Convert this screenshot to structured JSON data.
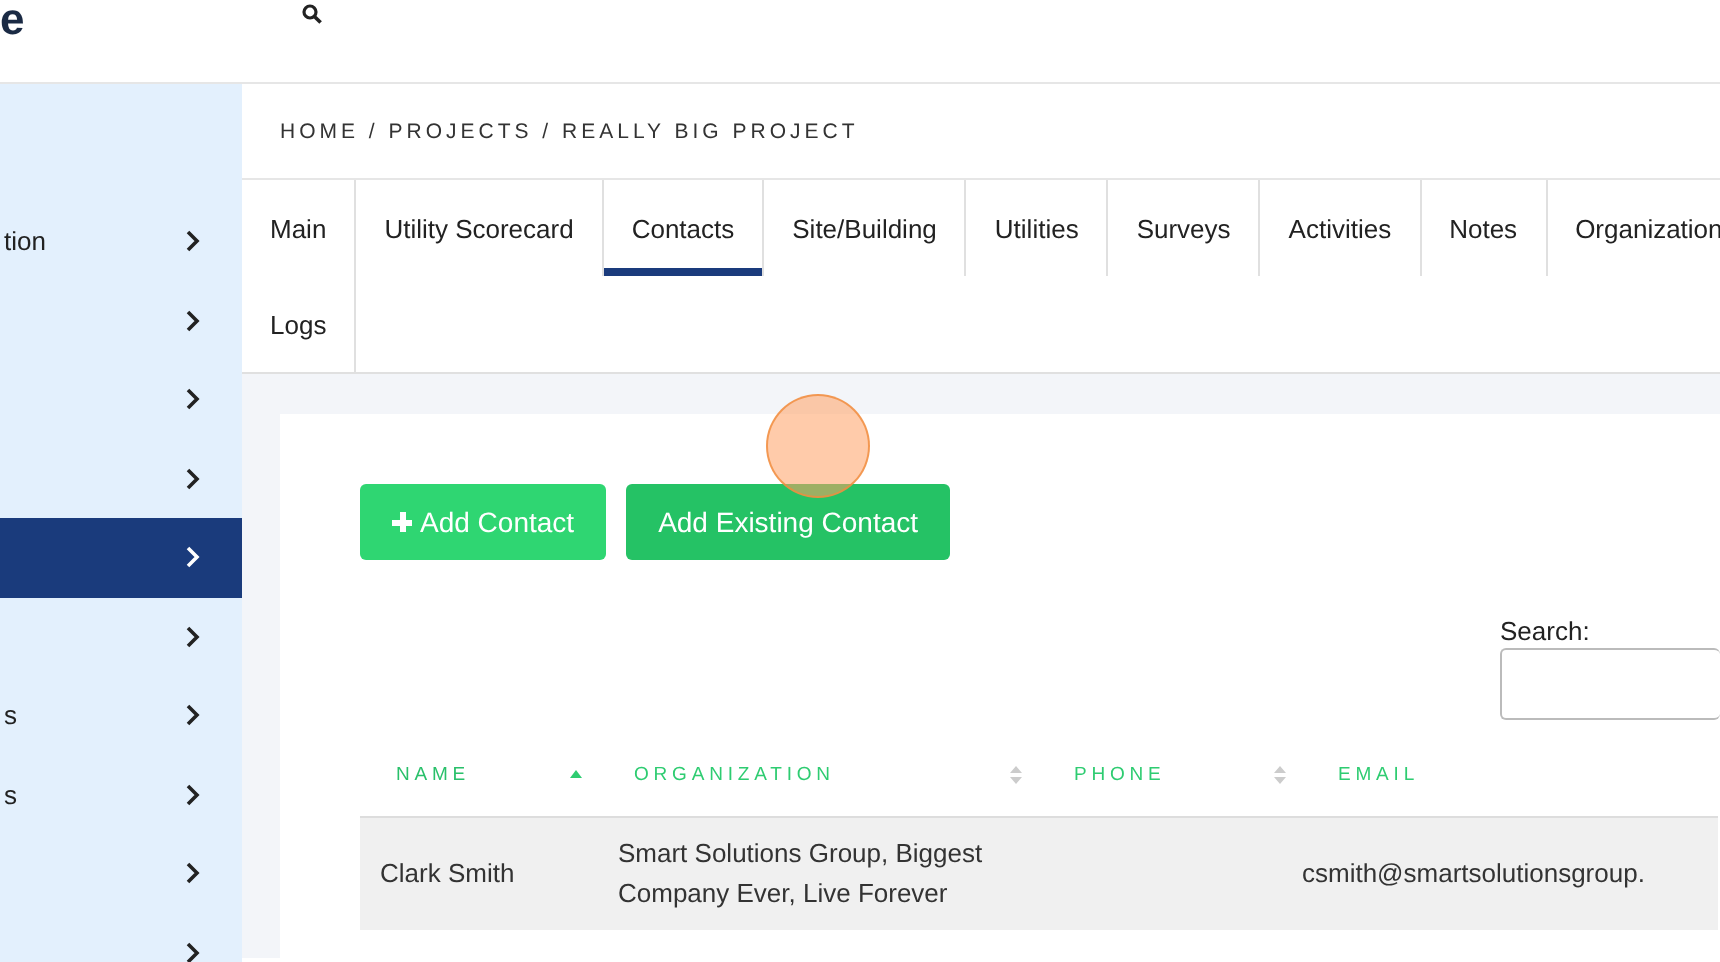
{
  "header": {
    "logo": "e"
  },
  "sidebar": {
    "items": [
      {
        "label": "tion",
        "selected": false
      },
      {
        "selected": false
      },
      {
        "selected": false
      },
      {
        "selected": false
      },
      {
        "selected": true
      },
      {
        "selected": false
      },
      {
        "label": "s",
        "selected": false
      },
      {
        "label": "s",
        "selected": false
      },
      {
        "selected": false
      },
      {
        "selected": false
      }
    ]
  },
  "breadcrumb": "HOME / PROJECTS / REALLY BIG PROJECT",
  "tabs": [
    {
      "label": "Main",
      "selected": false
    },
    {
      "label": "Utility Scorecard",
      "selected": false
    },
    {
      "label": "Contacts",
      "selected": true
    },
    {
      "label": "Site/Building",
      "selected": false
    },
    {
      "label": "Utilities",
      "selected": false
    },
    {
      "label": "Surveys",
      "selected": false
    },
    {
      "label": "Activities",
      "selected": false
    },
    {
      "label": "Notes",
      "selected": false
    },
    {
      "label": "Organization",
      "selected": false
    },
    {
      "label": "Logs",
      "selected": false
    }
  ],
  "buttons": [
    {
      "label": "Add Contact",
      "kind": "add"
    },
    {
      "label": "Add Existing Contact",
      "kind": "plain"
    }
  ],
  "search": {
    "label": "Search:"
  },
  "table": {
    "columns": [
      {
        "label": "NAME",
        "sortable": true,
        "sorted": true
      },
      {
        "label": "ORGANIZATION",
        "sortable": true,
        "sorted": false
      },
      {
        "label": "PHONE",
        "sortable": true,
        "sorted": false
      },
      {
        "label": "EMAIL"
      }
    ],
    "rows": [
      {
        "cells": [
          "Clark Smith",
          "Smart Solutions Group, Biggest Company Ever, Live Forever",
          "",
          "csmith@smartsolutionsgroup."
        ]
      }
    ]
  },
  "click_indicator": {
    "kind": "click"
  }
}
